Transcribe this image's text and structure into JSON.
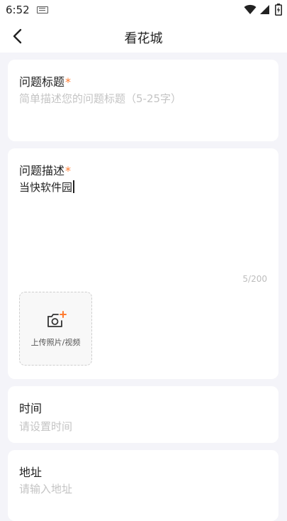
{
  "status_bar": {
    "time": "6:52"
  },
  "nav": {
    "title": "看花城"
  },
  "question_title": {
    "label": "问题标题",
    "required_mark": "*",
    "placeholder": "简单描述您的问题标题（5-25字）"
  },
  "question_desc": {
    "label": "问题描述",
    "required_mark": "*",
    "value": "当快软件园",
    "counter": "5/200"
  },
  "upload": {
    "label": "上传照片/视频"
  },
  "time_field": {
    "label": "时间",
    "placeholder": "请设置时间"
  },
  "address_field": {
    "label": "地址",
    "placeholder": "请输入地址"
  },
  "colors": {
    "accent": "#ff7a2f",
    "background": "#f4f4f9",
    "card": "#ffffff",
    "placeholder": "#c4c4c4"
  }
}
